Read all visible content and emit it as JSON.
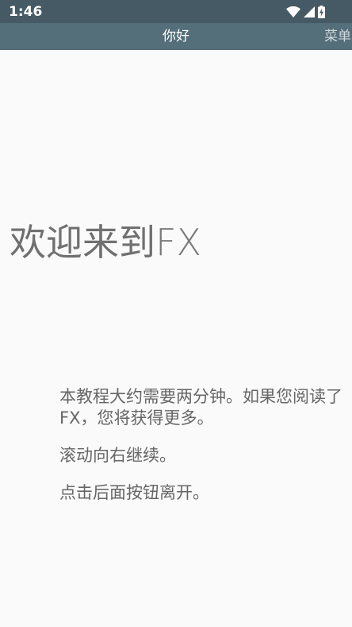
{
  "status_bar": {
    "time": "1:46",
    "icons": [
      "wifi-icon",
      "cell-signal-icon",
      "battery-charging-icon"
    ]
  },
  "app_bar": {
    "title": "你好",
    "menu_label": "菜单"
  },
  "content": {
    "title_main": "欢迎来到",
    "title_brand": "FX",
    "paragraphs": [
      "本教程大约需要两分钟。如果您阅读了FX，您将获得更多。",
      "滚动向右继续。",
      "点击后面按钮离开。"
    ]
  },
  "colors": {
    "status_bar_bg": "#455a64",
    "app_bar_bg": "#546e7a",
    "page_bg": "#fafafa",
    "text": "#666666"
  }
}
